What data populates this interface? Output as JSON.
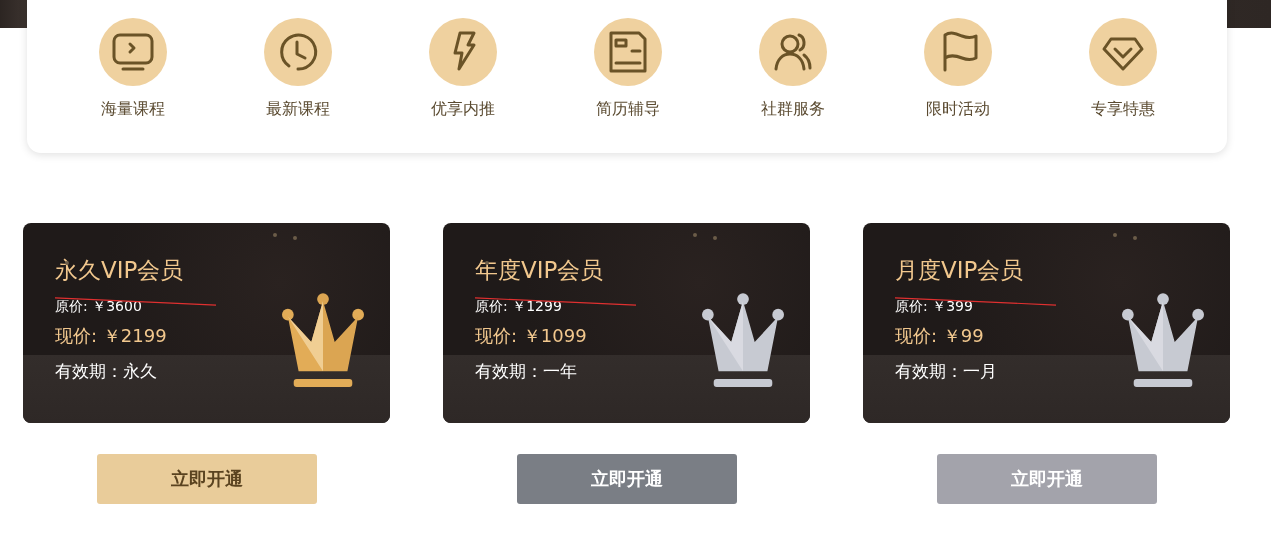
{
  "features": [
    {
      "kind": "monitor",
      "label": "海量课程"
    },
    {
      "kind": "clock",
      "label": "最新课程"
    },
    {
      "kind": "bolt",
      "label": "优享内推"
    },
    {
      "kind": "document",
      "label": "简历辅导"
    },
    {
      "kind": "people",
      "label": "社群服务"
    },
    {
      "kind": "flag",
      "label": "限时活动"
    },
    {
      "kind": "diamond",
      "label": "专享特惠"
    }
  ],
  "plans": [
    {
      "title": "永久VIP会员",
      "original_price": "原价: ￥3600",
      "current_price": "现价: ￥2199",
      "validity": "有效期：永久",
      "kind": "gold",
      "button": "立即开通",
      "color": "#e9cc9a"
    },
    {
      "title": "年度VIP会员",
      "original_price": "原价: ￥1299",
      "current_price": "现价: ￥1099",
      "validity": "有效期：一年",
      "kind": "silver",
      "button": "立即开通",
      "color": "#7a7e85"
    },
    {
      "title": "月度VIP会员",
      "original_price": "原价: ￥399",
      "current_price": "现价: ￥99",
      "validity": "有效期：一月",
      "kind": "silver",
      "button": "立即开通",
      "color": "#a3a3ab"
    }
  ]
}
